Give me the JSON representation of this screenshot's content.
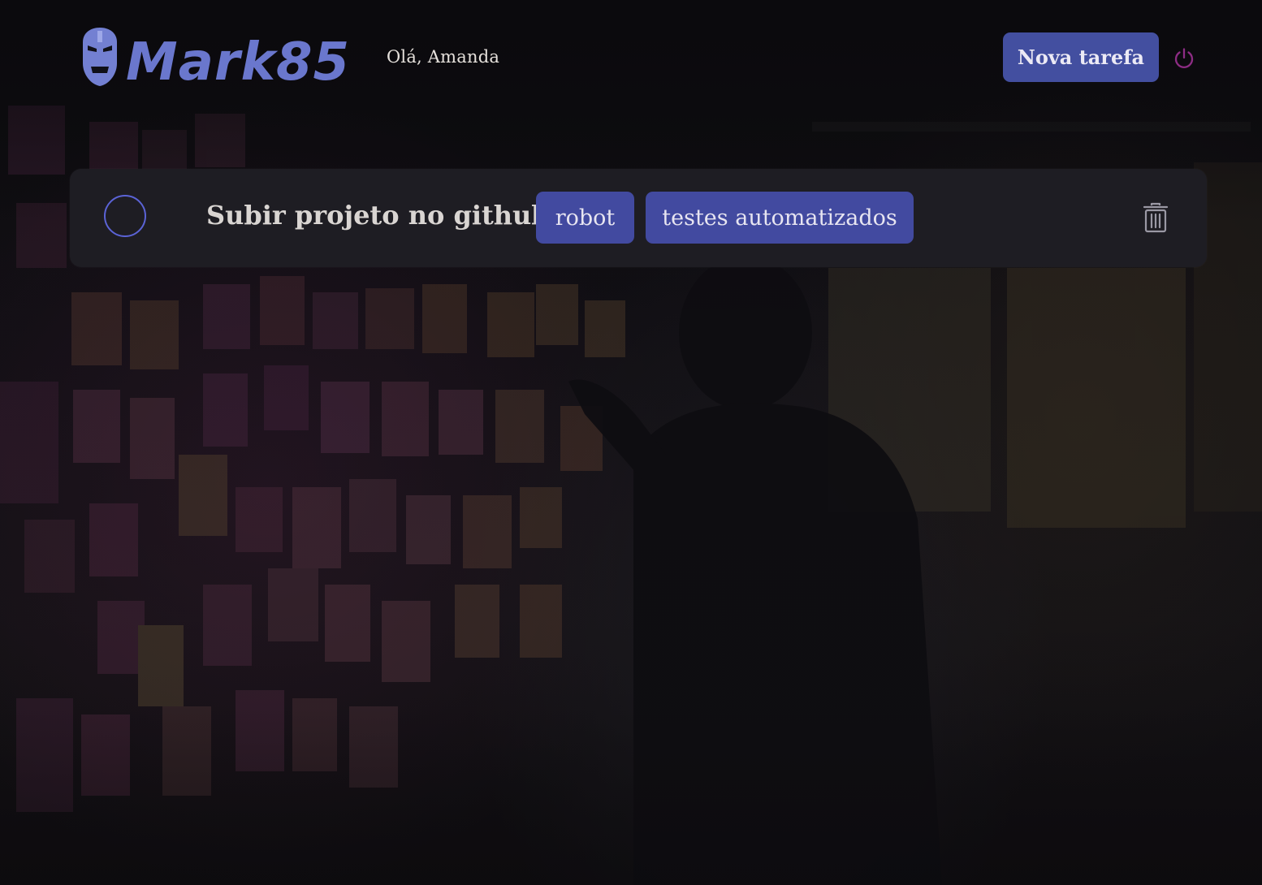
{
  "header": {
    "logo_text": "Mark85",
    "greeting": "Olá, Amanda",
    "new_task_label": "Nova tarefa",
    "logout_icon": "power-icon",
    "logo_icon": "iron-helmet-icon"
  },
  "tasks": [
    {
      "title": "Subir projeto no github",
      "done": false,
      "tags": [
        "robot",
        "testes automatizados"
      ],
      "delete_icon": "trash-icon"
    }
  ],
  "colors": {
    "accent": "#434fa0",
    "card_background": "#1e1d23",
    "logout_icon": "#8d2c84",
    "toggle_ring": "#5b63d6",
    "logo": "#7380d2"
  }
}
